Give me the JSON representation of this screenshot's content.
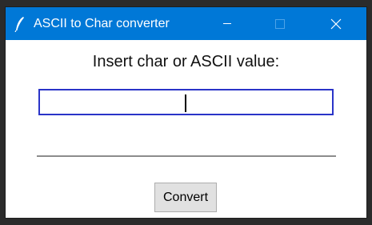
{
  "window": {
    "title": "ASCII to Char converter",
    "icon": "feather-icon",
    "controls": [
      "minimize-icon",
      "maximize-icon",
      "close-icon"
    ],
    "accent_color": "#0078d7"
  },
  "form": {
    "prompt": "Insert char or ASCII value:",
    "input_value": "",
    "input_border_color": "#2a34c8",
    "button_label": "Convert",
    "result": ""
  }
}
